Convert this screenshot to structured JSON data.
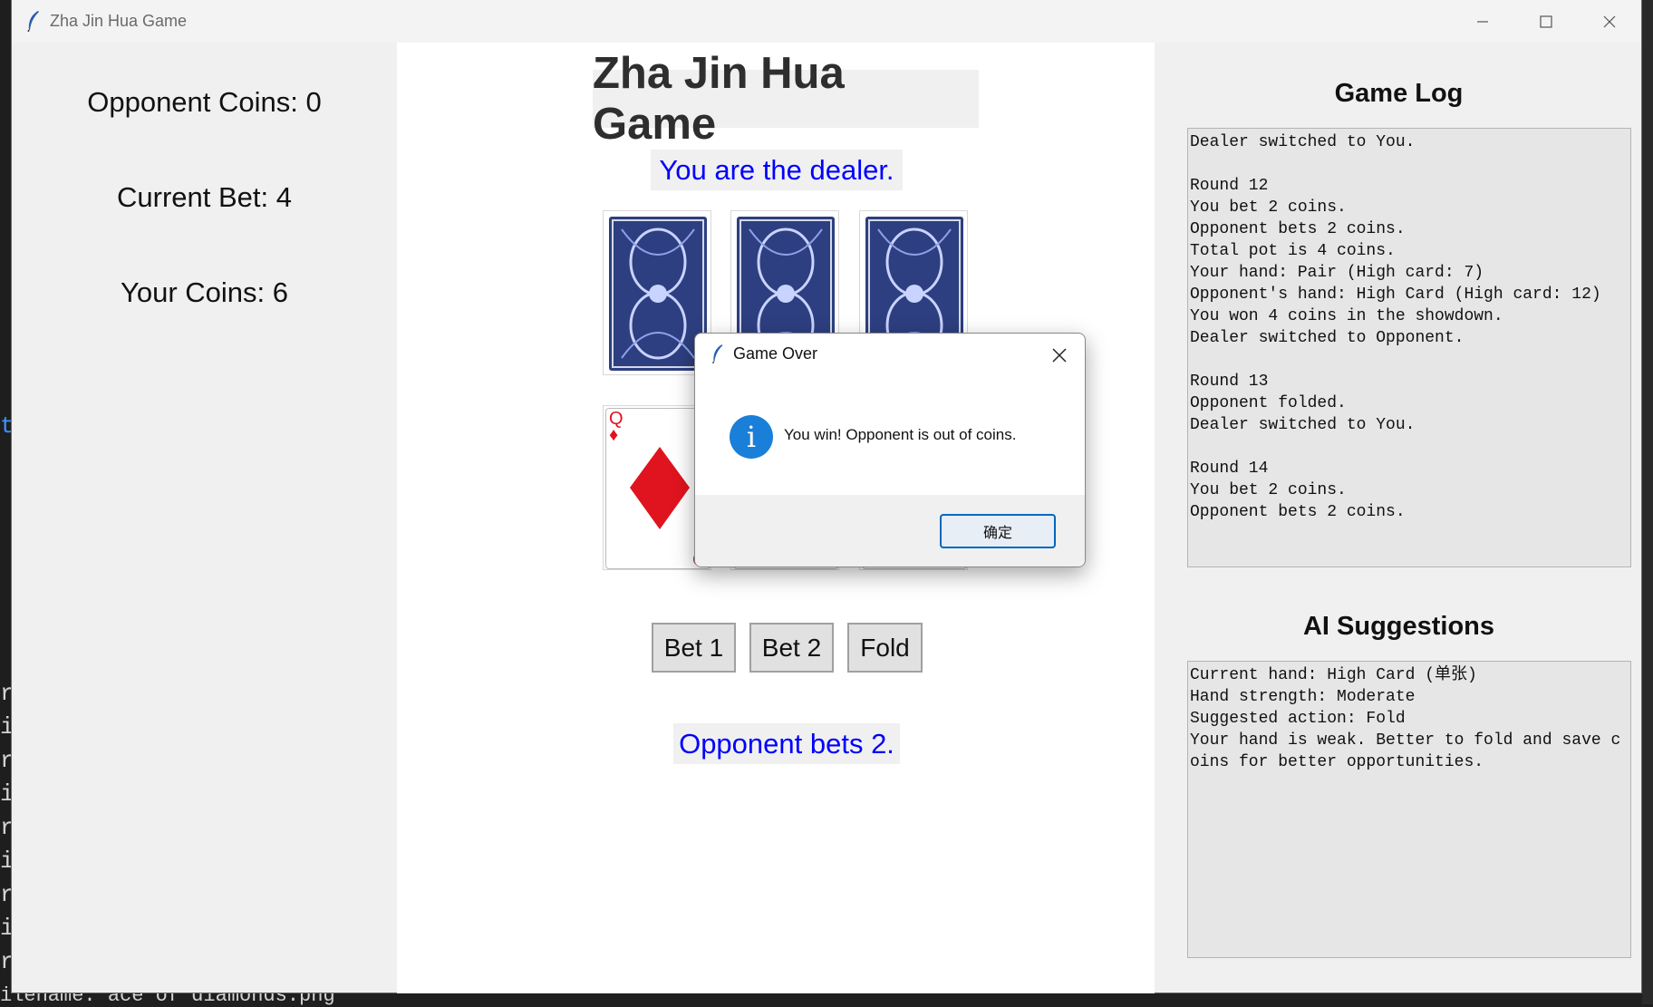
{
  "window": {
    "title": "Zha Jin Hua Game",
    "controls": [
      "minimize-icon",
      "maximize-icon",
      "close-icon"
    ]
  },
  "background_terminal": {
    "lines": [
      "r",
      "i",
      "r",
      "i",
      "r",
      "i",
      "r",
      "i",
      "r"
    ],
    "bottom_text": "ilename: ace of diamonds.png",
    "accent_char": "t"
  },
  "left_panel": {
    "opponent_coins": "Opponent Coins: 0",
    "current_bet": "Current Bet: 4",
    "your_coins": "Your Coins: 6"
  },
  "center": {
    "title": "Zha Jin Hua Game",
    "dealer_text": "You are the dealer.",
    "opponent_cards": [
      "card-back",
      "card-back",
      "card-back"
    ],
    "player_cards": [
      {
        "rank": "Q",
        "suit": "♦",
        "color": "#e0141e"
      },
      {
        "rank": "",
        "suit": "",
        "color": "#000000"
      },
      {
        "rank": "",
        "suit": "",
        "color": "#e0141e"
      }
    ],
    "buttons": {
      "bet1": "Bet 1",
      "bet2": "Bet 2",
      "fold": "Fold"
    },
    "status": "Opponent bets 2."
  },
  "right_panel": {
    "log_title": "Game Log",
    "log_text": "Dealer switched to You.\n\nRound 12\nYou bet 2 coins.\nOpponent bets 2 coins.\nTotal pot is 4 coins.\nYour hand: Pair (High card: 7)\nOpponent's hand: High Card (High card: 12)\nYou won 4 coins in the showdown.\nDealer switched to Opponent.\n\nRound 13\nOpponent folded.\nDealer switched to You.\n\nRound 14\nYou bet 2 coins.\nOpponent bets 2 coins.",
    "suggest_title": "AI Suggestions",
    "suggest_text": "Current hand: High Card (单张)\nHand strength: Moderate\nSuggested action: Fold\nYour hand is weak. Better to fold and save coins for better opportunities."
  },
  "dialog": {
    "title": "Game Over",
    "message": "You win! Opponent is out of coins.",
    "ok_label": "确定",
    "icon": "info-icon"
  },
  "colors": {
    "status_blue": "#0000ff",
    "card_red": "#e0141e",
    "card_back_blue": "#2d3f80",
    "info_blue": "#1a7fd8"
  }
}
